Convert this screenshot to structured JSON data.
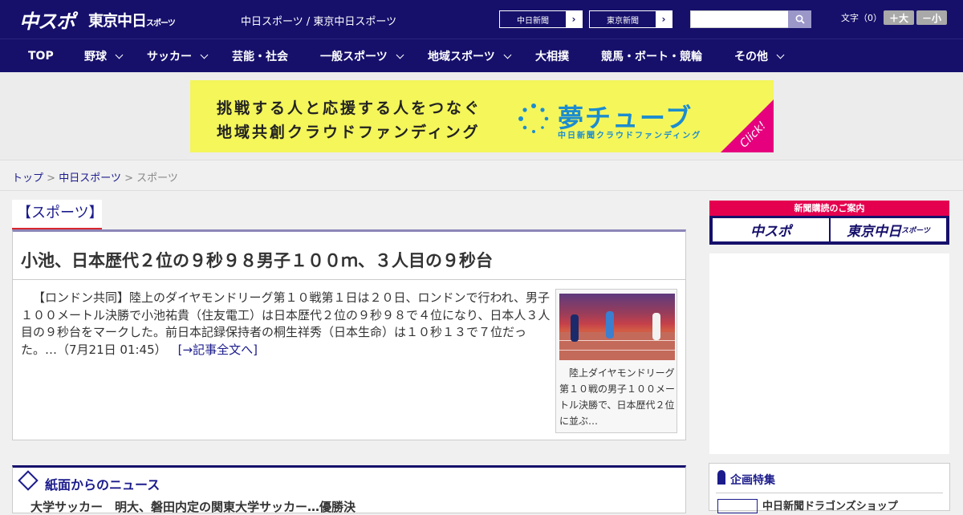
{
  "header": {
    "logo_chuspo": "中スポ",
    "logo_tokyo": "東京中日",
    "logo_tokyo_small": "スポーツ",
    "site_links": "中日スポーツ / 東京中日スポーツ",
    "paper_buttons": [
      {
        "label": "中日新聞"
      },
      {
        "label": "東京新聞"
      }
    ],
    "search": {
      "placeholder": ""
    },
    "font_size_label": "文字（0）",
    "font_larger": "＋大",
    "font_smaller": "－小"
  },
  "nav": {
    "items": [
      {
        "label": "TOP"
      },
      {
        "label": "野球"
      },
      {
        "label": "サッカー"
      },
      {
        "label": "芸能・社会"
      },
      {
        "label": "一般スポーツ"
      },
      {
        "label": "地域スポーツ"
      },
      {
        "label": "大相撲"
      },
      {
        "label": "競馬・ボート・競輪"
      },
      {
        "label": "その他"
      }
    ]
  },
  "banner": {
    "line1": "挑戦する人と応援する人をつなぐ",
    "line2": "地域共創クラウドファンディング",
    "brand": "夢チューブ",
    "brand_sub": "中日新聞クラウドファンディング",
    "click": "Click!"
  },
  "breadcrumb": {
    "home": "トップ",
    "sep": ">",
    "site": "中日スポーツ",
    "current": "スポーツ"
  },
  "section": {
    "title": "【スポーツ】"
  },
  "article": {
    "title": "小池、日本歴代２位の９秒９８男子１００ｍ、３人目の９秒台",
    "body": "【ロンドン共同】陸上のダイヤモンドリーグ第１０戦第１日は２０日、ロンドンで行われ、男子１００メートル決勝で小池祐貴（住友電工）は日本歴代２位の９秒９８で４位になり、日本人３人目の９秒台をマークした。前日本記録保持者の桐生祥秀（日本生命）は１０秒１３で７位だった。…",
    "date": "（7月21日 01:45）",
    "more_link": "[→記事全文へ]",
    "photo_caption": "陸上ダイヤモンドリーグ第１０戦の男子１００メートル決勝で、日本歴代２位に並ぶ…"
  },
  "news": {
    "title": "紙面からのニュース",
    "first_item": "大学サッカー　明大、磐田内定の関東大学サッカー…優勝決"
  },
  "sidebar": {
    "subscribe_head": "新聞購読のご案内",
    "subscribe_btn1": "中スポ",
    "subscribe_btn2": "東京中日",
    "subscribe_btn2_small": "スポーツ",
    "feature_title": "企画特集",
    "feature_item": "中日新聞ドラゴンズショップ"
  },
  "colors": {
    "navy": "#16106b",
    "red": "#d9272e",
    "pink": "#e4004f",
    "banner_yellow": "#f4f65a"
  }
}
